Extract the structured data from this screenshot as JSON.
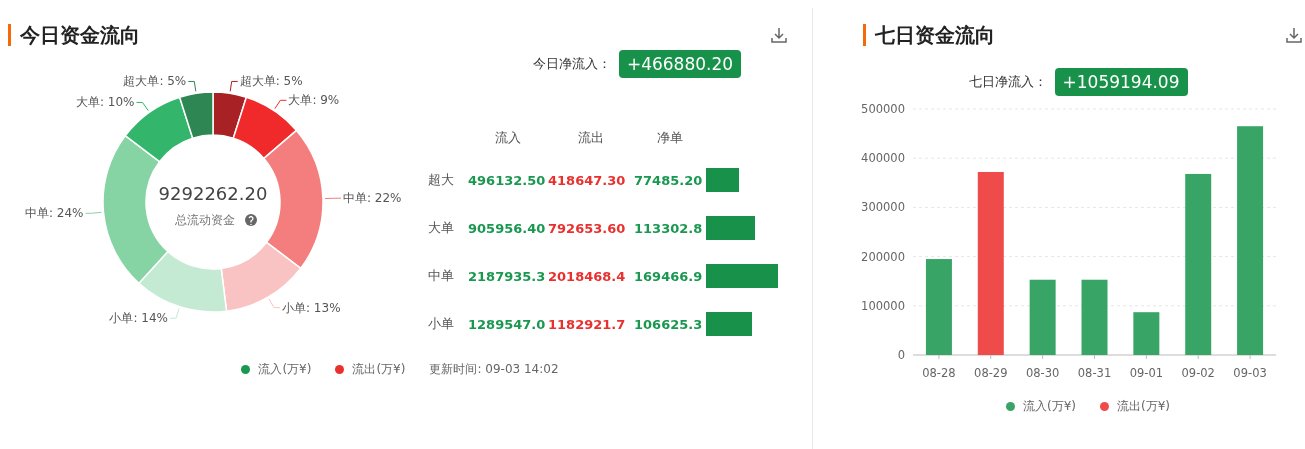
{
  "today": {
    "title": "今日资金流向",
    "net_label": "今日净流入：",
    "net_value": "+466880.20",
    "donut": {
      "total": "9292262.20",
      "total_label": "总流动资金",
      "slices": [
        {
          "color": "#a82125"
        },
        {
          "color": "#f0292a"
        },
        {
          "color": "#f47e7e"
        },
        {
          "color": "#f9c3c3"
        },
        {
          "color": "#c4ead4"
        },
        {
          "color": "#86d4a4"
        },
        {
          "color": "#33b56b"
        },
        {
          "color": "#2e8653"
        }
      ],
      "chart_data": {
        "type": "donut",
        "categories": [
          "超大单: 5%",
          "大单: 9%",
          "中单: 22%",
          "小单: 13%",
          "小单: 14%",
          "中单: 24%",
          "大单: 10%",
          "超大单: 5%"
        ],
        "values": [
          5,
          9,
          22,
          13,
          14,
          24,
          10,
          5
        ]
      }
    },
    "table": {
      "columns": [
        "流入",
        "流出",
        "净单"
      ],
      "rows": [
        {
          "label": "超大",
          "inflow": "496132.50",
          "outflow": "418647.30",
          "net": "77485.20",
          "level": 0.46
        },
        {
          "label": "大单",
          "inflow": "905956.40",
          "outflow": "792653.60",
          "net": "113302.8",
          "level": 0.68
        },
        {
          "label": "中单",
          "inflow": "2187935.3",
          "outflow": "2018468.4",
          "net": "169466.9",
          "level": 1.0
        },
        {
          "label": "小单",
          "inflow": "1289547.0",
          "outflow": "1182921.7",
          "net": "106625.3",
          "level": 0.64
        }
      ]
    },
    "legend": [
      {
        "label": "流入(万¥)",
        "color": "#1a9850"
      },
      {
        "label": "流出(万¥)",
        "color": "#e8312f"
      }
    ],
    "updated": "更新时间: 09-03 14:02"
  },
  "week": {
    "title": "七日资金流向",
    "net_label": "七日净流入：",
    "net_value": "+1059194.09",
    "chart_data": {
      "type": "bar",
      "categories": [
        "08-28",
        "08-29",
        "08-30",
        "08-31",
        "09-01",
        "09-02",
        "09-03"
      ],
      "series": [
        {
          "name": "流入(万¥)",
          "color": "#38a566",
          "values": [
            195000,
            null,
            153000,
            153000,
            87000,
            368000,
            465000
          ]
        },
        {
          "name": "流出(万¥)",
          "color": "#ef4b4b",
          "values": [
            null,
            372000,
            null,
            null,
            null,
            null,
            null
          ]
        }
      ],
      "ylim": [
        0,
        500000
      ],
      "grid": true,
      "yticks": [
        0,
        100000,
        200000,
        300000,
        400000,
        500000
      ],
      "stacked": true
    }
  }
}
